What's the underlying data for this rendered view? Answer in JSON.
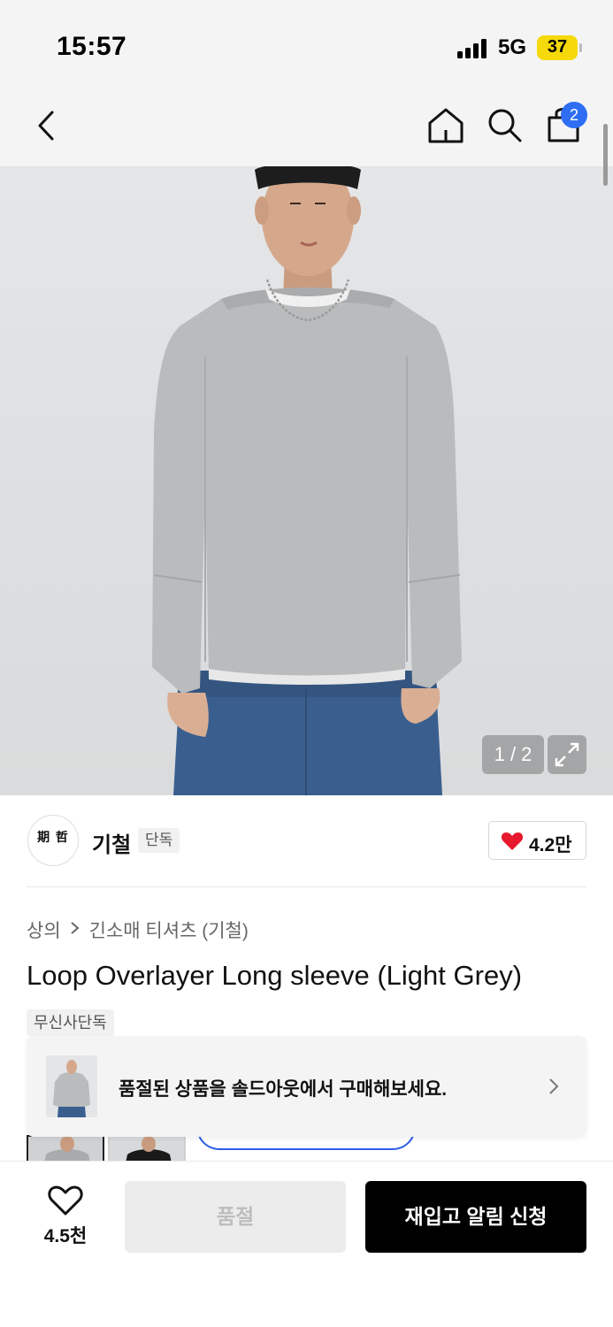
{
  "status_bar": {
    "time": "15:57",
    "network": "5G",
    "battery": "37"
  },
  "header": {
    "back_icon": "chevron-left-icon",
    "home_icon": "home-icon",
    "search_icon": "search-icon",
    "cart_icon": "shopping-bag-icon",
    "cart_count": "2",
    "badge_color": "#2f6ef3"
  },
  "gallery": {
    "counter": "1 / 2",
    "expand_icon": "expand-icon"
  },
  "brand": {
    "logo_text": "期 哲",
    "name": "기철",
    "tag": "단독",
    "likes": "4.2만",
    "heart_color": "#e8182e"
  },
  "breadcrumb": {
    "category": "상의",
    "subcategory": "긴소매 티셔츠 (기철)"
  },
  "product": {
    "title": "Loop Overlayer Long sleeve (Light Grey)",
    "exclusive_tag": "무신사단독"
  },
  "toast": {
    "message": "품절된 상품을 솔드아웃에서 구매해보세요."
  },
  "bottom_bar": {
    "wish_count": "4.5천",
    "soldout_label": "품절",
    "restock_label": "재입고 알림 신청"
  }
}
